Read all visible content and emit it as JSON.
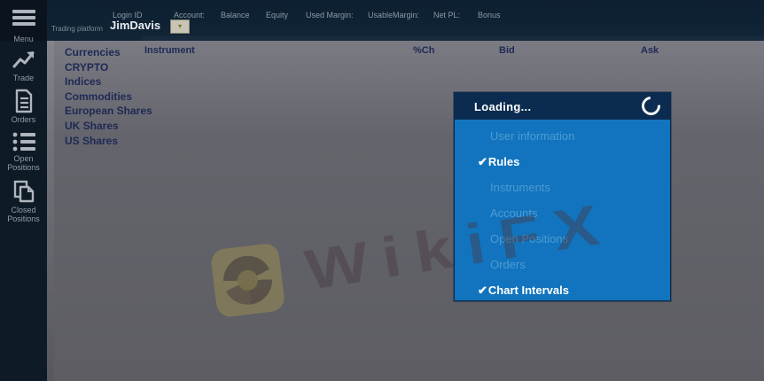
{
  "topbar": {
    "menu_label": "Menu",
    "platform_label": "Trading platform",
    "login_id_label": "Login ID",
    "login_id_value": "JimDavis",
    "account_label": "Account:",
    "fields": [
      "Balance",
      "Equity",
      "Used Margin:",
      "UsableMargin:",
      "Net PL:",
      "Bonus"
    ]
  },
  "sidebar": {
    "items": [
      {
        "label": "Trade",
        "icon": "chart-line-icon"
      },
      {
        "label": "Orders",
        "icon": "document-icon"
      },
      {
        "label": "Open Positions",
        "icon": "list-icon"
      },
      {
        "label": "Closed Positions",
        "icon": "documents-icon"
      }
    ]
  },
  "watchlist": {
    "columns": [
      "Instrument",
      "%Ch",
      "Bid",
      "Ask"
    ],
    "categories": [
      "Currencies",
      "CRYPTO",
      "Indices",
      "Commodities",
      "European Shares",
      "UK Shares",
      "US Shares"
    ]
  },
  "loading_dialog": {
    "title": "Loading...",
    "check_glyph": "✔",
    "items": [
      {
        "label": "User information",
        "checked": false,
        "glyph": ""
      },
      {
        "label": "Rules",
        "checked": true,
        "glyph": "✔"
      },
      {
        "label": "Instruments",
        "checked": false,
        "glyph": ""
      },
      {
        "label": "Accounts",
        "checked": false,
        "glyph": ""
      },
      {
        "label": "Open Positions",
        "checked": false,
        "glyph": ""
      },
      {
        "label": "Orders",
        "checked": false,
        "glyph": ""
      },
      {
        "label": "Chart Intervals",
        "checked": true,
        "glyph": "✔"
      }
    ]
  },
  "watermark": {
    "text": "WikiFX"
  },
  "colors": {
    "topbar_bg": "#0e2132",
    "sidebar_bg": "#0e1a26",
    "content_gray": "#5d5d63",
    "navy_text": "#1e2a55",
    "dialog_header_bg": "#0b2c50",
    "dialog_body_bg": "#1274be",
    "dialog_muted_text": "#4e9bd2",
    "watermark_gold": "#9b8e50"
  }
}
